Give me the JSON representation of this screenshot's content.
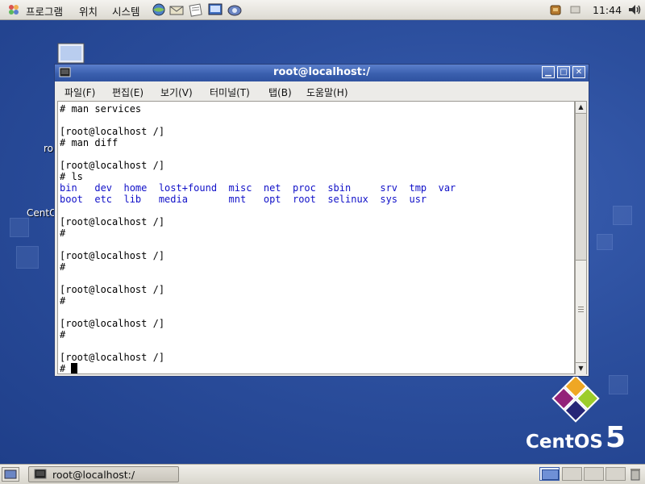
{
  "top_panel": {
    "menus": [
      {
        "label": "프로그램"
      },
      {
        "label": "위치"
      },
      {
        "label": "시스템"
      }
    ],
    "clock": "11:44"
  },
  "desktop": {
    "icon_labels": [
      "ro",
      "CentO"
    ],
    "brand": "CentOS",
    "brand_version": "5"
  },
  "terminal": {
    "title": "root@localhost:/",
    "menubar": [
      {
        "label": "파일(F)"
      },
      {
        "label": "편집(E)"
      },
      {
        "label": "보기(V)"
      },
      {
        "label": "터미널(T)"
      },
      {
        "label": "탭(B)"
      },
      {
        "label": "도움말(H)"
      }
    ],
    "lines_before": "# man services\n\n[root@localhost /]\n# man diff\n\n[root@localhost /]\n# ls",
    "ls_row1": "bin   dev  home  lost+found  misc  net  proc  sbin     srv  tmp  var",
    "ls_row2": "boot  etc  lib   media       mnt   opt  root  selinux  sys  usr",
    "lines_after": "\n[root@localhost /]\n#\n\n[root@localhost /]\n#\n\n[root@localhost /]\n#\n\n[root@localhost /]\n#\n\n[root@localhost /]",
    "prompt": "# "
  },
  "bottom_panel": {
    "task_label": "root@localhost:/"
  },
  "colors": {
    "titlebar": "#3a5fae",
    "desktop": "#2c4f9e",
    "dir_text": "#1010c8"
  }
}
